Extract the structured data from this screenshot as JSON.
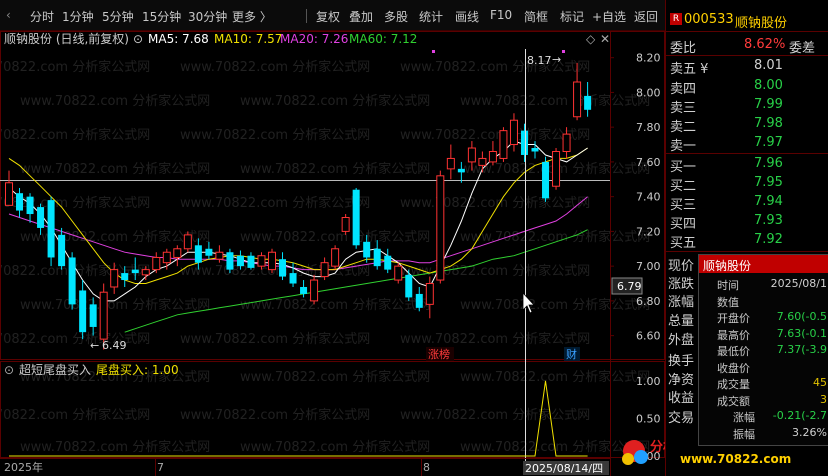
{
  "toolbar": {
    "left_items": [
      "分时",
      "1分钟",
      "5分钟",
      "15分钟",
      "30分钟",
      "更多 〉"
    ],
    "right_items": [
      "复权",
      "叠加",
      "多股",
      "统计",
      "画线",
      "F10",
      "简框",
      "标记",
      "+自选",
      "返回"
    ]
  },
  "chart_header": {
    "title": "顺钠股份 (日线,前复权)",
    "ma5": "MA5: 7.68",
    "ma10": "MA10: 7.57",
    "ma20": "MA20: 7.26",
    "ma60": "MA60: 7.12"
  },
  "indicator_header": {
    "name": "超短尾盘买入",
    "value": "尾盘买入: 1.00"
  },
  "annotations": {
    "high": "8.17",
    "low": "6.49",
    "price_tag": "6.79",
    "badge_zt": "涨榜",
    "badge_cai": "财"
  },
  "x_axis": {
    "left_label": "2025年",
    "m7": "7",
    "m8": "8",
    "cursor_date": "2025/08/14/四"
  },
  "y_ticks": [
    "8.20",
    "8.00",
    "7.80",
    "7.60",
    "7.40",
    "7.20",
    "7.00",
    "6.80",
    "6.60"
  ],
  "ind_ticks": [
    "1.00",
    "0.50",
    "0.00"
  ],
  "stock": {
    "code": "000533",
    "name": "顺钠股份",
    "r_badge": "R"
  },
  "order_book": {
    "weibi_label": "委比",
    "weibi_value": "8.62%",
    "weicha_label": "委差",
    "sell": [
      {
        "label": "卖五 ¥",
        "price": "8.01",
        "color": "#d0d0d0"
      },
      {
        "label": "卖四",
        "price": "8.00",
        "color": "#28d048"
      },
      {
        "label": "卖三",
        "price": "7.99",
        "color": "#28d048"
      },
      {
        "label": "卖二",
        "price": "7.98",
        "color": "#28d048"
      },
      {
        "label": "卖一",
        "price": "7.97",
        "color": "#28d048"
      }
    ],
    "buy": [
      {
        "label": "买一",
        "price": "7.96",
        "color": "#28d048"
      },
      {
        "label": "买二",
        "price": "7.95",
        "color": "#28d048"
      },
      {
        "label": "买三",
        "price": "7.94",
        "color": "#28d048"
      },
      {
        "label": "买四",
        "price": "7.93",
        "color": "#28d048"
      },
      {
        "label": "买五",
        "price": "7.92",
        "color": "#28d048"
      }
    ]
  },
  "side_tabs": [
    "现价",
    "涨跌",
    "涨幅",
    "总量",
    "外盘",
    "换手",
    "净资",
    "收益",
    "交易"
  ],
  "popup": {
    "title": "顺钠股份",
    "rows": [
      {
        "k": "时间",
        "v": "2025/08/1",
        "c": "#d0d0d0"
      },
      {
        "k": "数值",
        "v": "",
        "c": "#d0d0d0"
      },
      {
        "k": "开盘价",
        "v": "7.60(-0.5",
        "c": "#28d048"
      },
      {
        "k": "最高价",
        "v": "7.63(-0.1",
        "c": "#28d048"
      },
      {
        "k": "最低价",
        "v": "7.37(-3.9",
        "c": "#28d048"
      },
      {
        "k": "收盘价",
        "v": "",
        "c": "#d0d0d0"
      },
      {
        "k": "成交量",
        "v": "45",
        "c": "#e0c000"
      },
      {
        "k": "成交额",
        "v": "3",
        "c": "#e0c000"
      },
      {
        "k": "涨幅",
        "v": "-0.21(-2.7",
        "c": "#28d048"
      },
      {
        "k": "振幅",
        "v": "3.26%",
        "c": "#d0d0d0"
      }
    ]
  },
  "watermark": {
    "text": "分析家公式网",
    "url": "www.70822.com"
  },
  "colors": {
    "up": "#ff3333",
    "down": "#00e5ff",
    "ma5": "#ffffff",
    "ma10": "#f0e000",
    "ma20": "#e040e0",
    "ma60": "#30d030"
  },
  "chart_data": {
    "type": "candlestick",
    "ylim": [
      6.5,
      8.25
    ],
    "candles": [
      {
        "o": 7.35,
        "h": 7.55,
        "l": 7.35,
        "c": 7.48
      },
      {
        "o": 7.42,
        "h": 7.45,
        "l": 7.28,
        "c": 7.32
      },
      {
        "o": 7.4,
        "h": 7.42,
        "l": 7.25,
        "c": 7.3
      },
      {
        "o": 7.34,
        "h": 7.36,
        "l": 7.18,
        "c": 7.22
      },
      {
        "o": 7.38,
        "h": 7.4,
        "l": 7.0,
        "c": 7.05
      },
      {
        "o": 7.18,
        "h": 7.22,
        "l": 6.98,
        "c": 7.0
      },
      {
        "o": 7.05,
        "h": 7.08,
        "l": 6.75,
        "c": 6.78
      },
      {
        "o": 6.86,
        "h": 6.92,
        "l": 6.58,
        "c": 6.62
      },
      {
        "o": 6.78,
        "h": 6.82,
        "l": 6.6,
        "c": 6.65
      },
      {
        "o": 6.58,
        "h": 6.9,
        "l": 6.52,
        "c": 6.85
      },
      {
        "o": 6.88,
        "h": 7.02,
        "l": 6.84,
        "c": 6.98
      },
      {
        "o": 6.96,
        "h": 7.0,
        "l": 6.88,
        "c": 6.92
      },
      {
        "o": 6.98,
        "h": 7.05,
        "l": 6.92,
        "c": 6.96
      },
      {
        "o": 6.95,
        "h": 7.0,
        "l": 6.92,
        "c": 6.98
      },
      {
        "o": 6.98,
        "h": 7.08,
        "l": 6.96,
        "c": 7.05
      },
      {
        "o": 7.02,
        "h": 7.1,
        "l": 6.98,
        "c": 7.08
      },
      {
        "o": 7.05,
        "h": 7.12,
        "l": 7.0,
        "c": 7.1
      },
      {
        "o": 7.1,
        "h": 7.2,
        "l": 7.08,
        "c": 7.18
      },
      {
        "o": 7.12,
        "h": 7.16,
        "l": 6.98,
        "c": 7.02
      },
      {
        "o": 7.1,
        "h": 7.14,
        "l": 7.04,
        "c": 7.06
      },
      {
        "o": 7.04,
        "h": 7.12,
        "l": 7.02,
        "c": 7.08
      },
      {
        "o": 7.08,
        "h": 7.1,
        "l": 6.96,
        "c": 6.98
      },
      {
        "o": 7.06,
        "h": 7.09,
        "l": 6.98,
        "c": 7.0
      },
      {
        "o": 7.06,
        "h": 7.08,
        "l": 6.98,
        "c": 6.99
      },
      {
        "o": 7.0,
        "h": 7.08,
        "l": 6.98,
        "c": 7.06
      },
      {
        "o": 6.98,
        "h": 7.1,
        "l": 6.96,
        "c": 7.08
      },
      {
        "o": 7.04,
        "h": 7.08,
        "l": 6.92,
        "c": 6.94
      },
      {
        "o": 6.96,
        "h": 7.02,
        "l": 6.88,
        "c": 6.9
      },
      {
        "o": 6.88,
        "h": 6.92,
        "l": 6.82,
        "c": 6.84
      },
      {
        "o": 6.8,
        "h": 6.95,
        "l": 6.78,
        "c": 6.92
      },
      {
        "o": 6.94,
        "h": 7.05,
        "l": 6.92,
        "c": 7.02
      },
      {
        "o": 7.0,
        "h": 7.12,
        "l": 6.98,
        "c": 7.1
      },
      {
        "o": 7.2,
        "h": 7.3,
        "l": 7.18,
        "c": 7.28
      },
      {
        "o": 7.44,
        "h": 7.45,
        "l": 7.1,
        "c": 7.12
      },
      {
        "o": 7.14,
        "h": 7.18,
        "l": 7.02,
        "c": 7.05
      },
      {
        "o": 7.1,
        "h": 7.15,
        "l": 6.98,
        "c": 7.0
      },
      {
        "o": 7.06,
        "h": 7.1,
        "l": 6.96,
        "c": 6.98
      },
      {
        "o": 6.92,
        "h": 7.02,
        "l": 6.9,
        "c": 7.0
      },
      {
        "o": 6.95,
        "h": 6.98,
        "l": 6.8,
        "c": 6.82
      },
      {
        "o": 6.84,
        "h": 6.88,
        "l": 6.74,
        "c": 6.76
      },
      {
        "o": 6.78,
        "h": 6.94,
        "l": 6.7,
        "c": 6.9
      },
      {
        "o": 6.92,
        "h": 7.55,
        "l": 6.9,
        "c": 7.52
      },
      {
        "o": 7.56,
        "h": 7.7,
        "l": 7.5,
        "c": 7.62
      },
      {
        "o": 7.56,
        "h": 7.6,
        "l": 7.48,
        "c": 7.54
      },
      {
        "o": 7.6,
        "h": 7.72,
        "l": 7.55,
        "c": 7.68
      },
      {
        "o": 7.58,
        "h": 7.66,
        "l": 7.54,
        "c": 7.62
      },
      {
        "o": 7.6,
        "h": 7.72,
        "l": 7.58,
        "c": 7.66
      },
      {
        "o": 7.62,
        "h": 7.8,
        "l": 7.6,
        "c": 7.78
      },
      {
        "o": 7.7,
        "h": 7.88,
        "l": 7.66,
        "c": 7.84
      },
      {
        "o": 7.78,
        "h": 7.82,
        "l": 7.6,
        "c": 7.64
      },
      {
        "o": 7.68,
        "h": 7.72,
        "l": 7.62,
        "c": 7.66
      },
      {
        "o": 7.6,
        "h": 7.63,
        "l": 7.37,
        "c": 7.39
      },
      {
        "o": 7.46,
        "h": 7.68,
        "l": 7.44,
        "c": 7.66
      },
      {
        "o": 7.66,
        "h": 7.8,
        "l": 7.62,
        "c": 7.76
      },
      {
        "o": 7.86,
        "h": 8.17,
        "l": 7.84,
        "c": 8.06
      },
      {
        "o": 7.98,
        "h": 8.06,
        "l": 7.86,
        "c": 7.9
      }
    ],
    "ma5": [
      7.45,
      7.4,
      7.36,
      7.3,
      7.22,
      7.12,
      7.02,
      6.92,
      6.84,
      6.8,
      6.8,
      6.84,
      6.88,
      6.94,
      6.98,
      7.0,
      7.04,
      7.08,
      7.08,
      7.08,
      7.07,
      7.06,
      7.04,
      7.02,
      7.02,
      7.02,
      7.01,
      6.99,
      6.96,
      6.94,
      6.94,
      6.96,
      7.04,
      7.08,
      7.09,
      7.1,
      7.06,
      7.02,
      6.96,
      6.9,
      6.88,
      7.0,
      7.12,
      7.26,
      7.42,
      7.56,
      7.62,
      7.66,
      7.72,
      7.7,
      7.7,
      7.64,
      7.62,
      7.6,
      7.64,
      7.68
    ],
    "ma10": [
      7.62,
      7.58,
      7.52,
      7.46,
      7.4,
      7.34,
      7.26,
      7.18,
      7.1,
      7.02,
      6.96,
      6.92,
      6.9,
      6.9,
      6.92,
      6.94,
      6.96,
      7.0,
      7.02,
      7.04,
      7.05,
      7.06,
      7.06,
      7.05,
      7.04,
      7.04,
      7.03,
      7.02,
      7.0,
      6.98,
      6.98,
      6.98,
      7.0,
      7.02,
      7.04,
      7.04,
      7.03,
      7.02,
      7.0,
      6.98,
      6.96,
      6.98,
      7.0,
      7.04,
      7.1,
      7.2,
      7.3,
      7.4,
      7.48,
      7.54,
      7.58,
      7.6,
      7.62,
      7.62,
      7.64,
      7.68
    ],
    "ma20": [
      7.3,
      7.28,
      7.26,
      7.24,
      7.22,
      7.2,
      7.18,
      7.16,
      7.14,
      7.12,
      7.1,
      7.08,
      7.07,
      7.06,
      7.05,
      7.05,
      7.04,
      7.04,
      7.04,
      7.04,
      7.04,
      7.03,
      7.03,
      7.02,
      7.01,
      7.0,
      7.0,
      6.99,
      6.98,
      6.98,
      6.98,
      6.98,
      6.99,
      7.0,
      7.01,
      7.02,
      7.03,
      7.03,
      7.03,
      7.02,
      7.02,
      7.04,
      7.06,
      7.08,
      7.1,
      7.12,
      7.14,
      7.16,
      7.18,
      7.2,
      7.22,
      7.24,
      7.26,
      7.3,
      7.35,
      7.4
    ],
    "ma60": [
      null,
      null,
      null,
      null,
      null,
      null,
      null,
      null,
      null,
      null,
      null,
      6.62,
      6.64,
      6.66,
      6.68,
      6.7,
      6.72,
      6.73,
      6.74,
      6.75,
      6.76,
      6.77,
      6.78,
      6.79,
      6.8,
      6.81,
      6.82,
      6.83,
      6.84,
      6.85,
      6.86,
      6.87,
      6.88,
      6.89,
      6.9,
      6.91,
      6.92,
      6.93,
      6.94,
      6.95,
      6.96,
      6.97,
      6.98,
      6.99,
      7.0,
      7.02,
      7.04,
      7.05,
      7.06,
      7.08,
      7.1,
      7.12,
      7.14,
      7.16,
      7.18,
      7.21
    ],
    "indicator": [
      0,
      0,
      0,
      0,
      0,
      0,
      0,
      0,
      0,
      0,
      0,
      0,
      0,
      0,
      0,
      0,
      0,
      0,
      0,
      0,
      0,
      0,
      0,
      0,
      0,
      0,
      0,
      0,
      0,
      0,
      0,
      0,
      0,
      0,
      0,
      0,
      0,
      0,
      0,
      0,
      0,
      0,
      0,
      0,
      0,
      0,
      0,
      0,
      0,
      0,
      0,
      1,
      0,
      0,
      0,
      0
    ]
  }
}
